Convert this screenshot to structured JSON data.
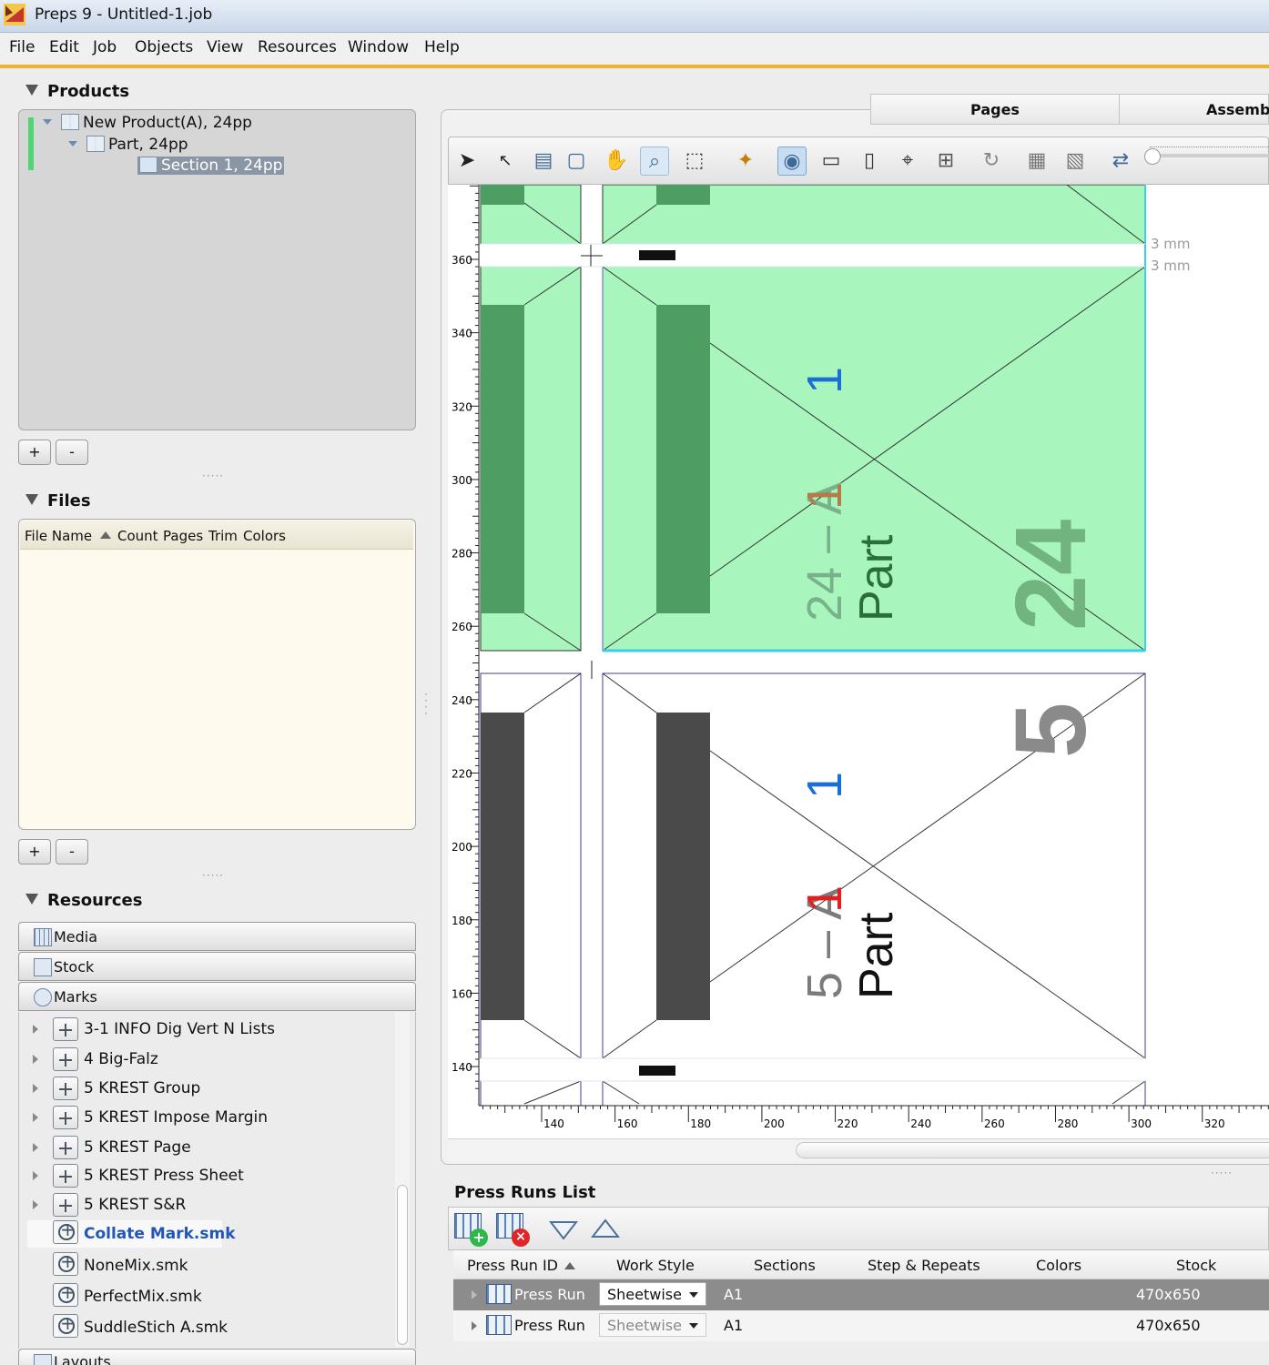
{
  "window": {
    "title": "Preps 9 - Untitled-1.job"
  },
  "menu": [
    "File",
    "Edit",
    "Job",
    "Objects",
    "View",
    "Resources",
    "Window",
    "Help"
  ],
  "products": {
    "heading": "Products",
    "tree": [
      {
        "label": "New Product(A), 24pp"
      },
      {
        "label": "Part, 24pp"
      },
      {
        "label": "Section 1, 24pp"
      }
    ],
    "add_label": "+",
    "remove_label": "-"
  },
  "files": {
    "heading": "Files",
    "columns": [
      "File Name",
      "Count",
      "Pages",
      "Trim",
      "Colors"
    ],
    "add_label": "+",
    "remove_label": "-"
  },
  "resources": {
    "heading": "Resources",
    "categories": [
      "Media",
      "Stock",
      "Marks"
    ],
    "marks": [
      "3-1 INFO Dig Vert N Lists",
      "4 Big-Falz",
      "5 KREST Group",
      "5 KREST Impose Margin",
      "5 KREST Page",
      "5 KREST Press Sheet",
      "5 KREST S&R",
      "Collate Mark.smk",
      "NoneMix.smk",
      "PerfectMix.smk",
      "SuddleStich A.smk"
    ],
    "next_category": "Layouts"
  },
  "tabs": [
    "Pages",
    "Assembl"
  ],
  "canvas": {
    "gap_label_top": "3 mm",
    "gap_label_bottom": "3 mm",
    "y_ticks": [
      "360",
      "340",
      "320",
      "300",
      "280",
      "260",
      "240",
      "220",
      "200",
      "180",
      "160",
      "140"
    ],
    "x_ticks": [
      "140",
      "160",
      "180",
      "200",
      "220",
      "240",
      "260",
      "280",
      "300",
      "320"
    ],
    "page_top": {
      "folio": "24 – A",
      "sig": "1",
      "sig2": "1",
      "part": "Part",
      "big": "24"
    },
    "page_bottom": {
      "folio": "5 – A",
      "sig": "1",
      "sig2": "1",
      "part": "Part",
      "big": "5"
    }
  },
  "press_runs": {
    "title": "Press Runs List",
    "columns": [
      "Press Run ID",
      "Work Style",
      "Sections",
      "Step & Repeats",
      "Colors",
      "Stock"
    ],
    "rows": [
      {
        "id": "Press Run",
        "work_style": "Sheetwise",
        "sections": "A1",
        "step_repeats": "",
        "colors": "",
        "stock": "470x650"
      },
      {
        "id": "Press Run",
        "work_style": "Sheetwise",
        "sections": "A1",
        "step_repeats": "",
        "colors": "",
        "stock": "470x650"
      }
    ]
  },
  "colors": {
    "accent": "#f0b030",
    "selected_page": "#a8f5be",
    "spine_dark": "#4e9e63",
    "spine_gray": "#4a4a4a",
    "selection_row": "#8c8c8c",
    "marker_red": "#e32020",
    "marker_blue": "#1a6fd6"
  }
}
